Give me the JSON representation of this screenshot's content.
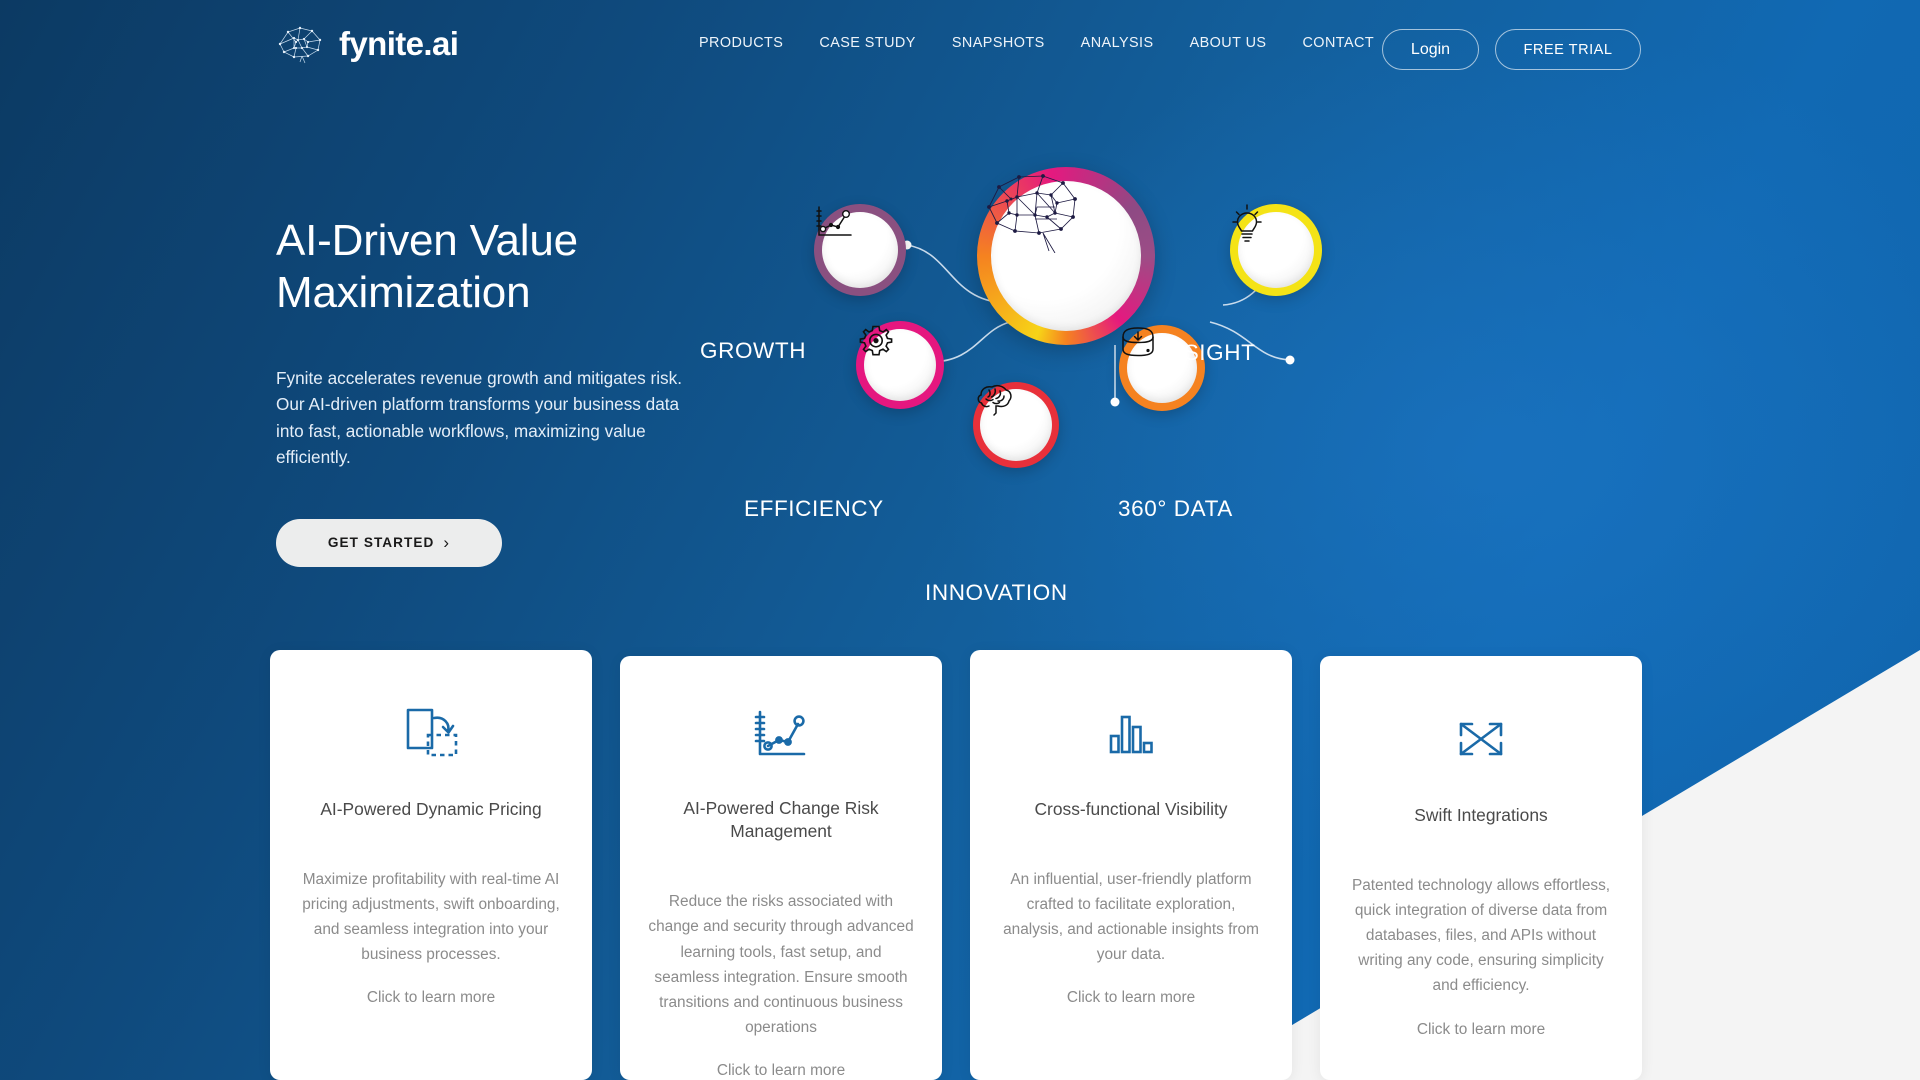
{
  "brand": {
    "name": "fynite.ai",
    "logo_icon": "brain-network-icon"
  },
  "nav": {
    "items": [
      {
        "label": "PRODUCTS"
      },
      {
        "label": "CASE STUDY"
      },
      {
        "label": "SNAPSHOTS"
      },
      {
        "label": "ANALYSIS"
      },
      {
        "label": "ABOUT US"
      },
      {
        "label": "CONTACT"
      }
    ],
    "login_label": "Login",
    "trial_label": "FREE TRIAL"
  },
  "hero": {
    "title": "AI-Driven Value Maximization",
    "subtitle": "Fynite accelerates revenue growth and mitigates risk. Our AI-driven platform transforms your business data into fast, actionable workflows, maximizing value efficiently.",
    "cta_label": "GET STARTED",
    "cta_chevron": "chevron-right-icon"
  },
  "diagram": {
    "center": {
      "label": "",
      "icon": "brain-network-icon",
      "ring_colors": [
        "#f7d417",
        "#f58220",
        "#e5197f",
        "#8e4a84"
      ]
    },
    "nodes": [
      {
        "label": "GROWTH",
        "icon": "growth-chart-icon",
        "ring_color": "#8a5080"
      },
      {
        "label": "INSIGHT",
        "icon": "lightbulb-icon",
        "ring_color": "#f4e316"
      },
      {
        "label": "EFFICIENCY",
        "icon": "gear-icon",
        "ring_color": "#e5177f"
      },
      {
        "label": "INNOVATION",
        "icon": "brain-icon",
        "ring_color": "#e8303a"
      },
      {
        "label": "360° DATA",
        "icon": "data-download-icon",
        "ring_color": "#f58220"
      }
    ]
  },
  "cards": [
    {
      "icon": "dynamic-pricing-icon",
      "title": "AI-Powered Dynamic Pricing",
      "description": "Maximize profitability with real-time AI pricing adjustments, swift onboarding, and seamless integration into your business processes.",
      "link_label": "Click to learn more"
    },
    {
      "icon": "change-risk-chart-icon",
      "title": "AI-Powered Change Risk Management",
      "description": "Reduce the risks associated with change and security through advanced learning tools, fast setup, and seamless integration. Ensure smooth transitions and continuous business operations",
      "link_label": "Click to learn more"
    },
    {
      "icon": "bar-chart-icon",
      "title": "Cross-functional Visibility",
      "description": "An influential, user-friendly platform crafted to facilitate exploration, analysis, and actionable insights from your data.",
      "link_label": "Click to learn more"
    },
    {
      "icon": "swift-integration-icon",
      "title": "Swift Integrations",
      "description": "Patented technology allows effortless, quick integration of diverse data from databases, files, and APIs without writing any code, ensuring simplicity and efficiency.",
      "link_label": "Click to learn more"
    }
  ],
  "colors": {
    "hero_blue_dark": "#0c3a63",
    "hero_blue": "#1169b3",
    "card_icon_blue": "#1a6aa8",
    "accent_magenta": "#e5197f",
    "accent_orange": "#f58220",
    "accent_yellow": "#f7d417"
  }
}
